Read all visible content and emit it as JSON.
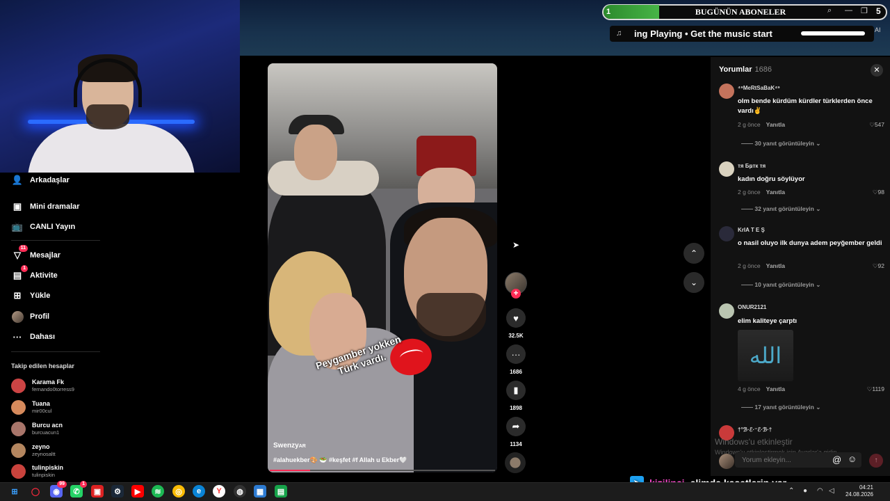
{
  "stream_overlay": {
    "subscriber_goal": {
      "count": "1",
      "title": "BUGÜNÜN ABONELER",
      "digit": "5"
    },
    "music_ticker": {
      "text": "ing Playing  •  Get the music start",
      "ai_label": "AI"
    },
    "chat_message": {
      "user": "kizilinci",
      "text": "elimde kasetlerin var"
    }
  },
  "sidebar": {
    "items": [
      {
        "label": "Arkadaşlar",
        "icon": "friends-icon"
      },
      {
        "label": "Mini dramalar",
        "icon": "mini-drama-icon"
      },
      {
        "label": "CANLI Yayın",
        "icon": "live-icon"
      },
      {
        "label": "Mesajlar",
        "icon": "messages-icon",
        "badge": "11"
      },
      {
        "label": "Aktivite",
        "icon": "activity-icon",
        "badge": "1"
      },
      {
        "label": "Yükle",
        "icon": "upload-icon"
      },
      {
        "label": "Profil",
        "icon": "profile-avatar"
      },
      {
        "label": "Dahası",
        "icon": "more-icon"
      }
    ],
    "following_title": "Takip edilen hesaplar",
    "following": [
      {
        "name": "Karama Fk",
        "handle": "fernando0torress9",
        "color": "#c44"
      },
      {
        "name": "Tuana",
        "handle": "mir00cul",
        "color": "#d68a5c"
      },
      {
        "name": "Burcu acn",
        "handle": "burcuacun1",
        "color": "#a8756a"
      },
      {
        "name": "zeyno",
        "handle": "zeynosaltt",
        "color": "#b4865f"
      },
      {
        "name": "tulinpiskin",
        "handle": "tulinpiskin",
        "color": "#c9433d"
      }
    ]
  },
  "video": {
    "caption_line1": "Peygamber yokken",
    "caption_line2": "Türk vardı.",
    "author": "Swenzy",
    "author_suffix": "AR",
    "tags": "#alahuekber🎨 🥗 #keşfet #f Allah u Ekber🤍",
    "progress": 0.18
  },
  "actions": {
    "likes": "32.5K",
    "comments": "1686",
    "saves": "1898",
    "shares": "1134"
  },
  "comments_panel": {
    "title": "Yorumlar",
    "count": "1686",
    "reply_label": "Yanıtla",
    "input_placeholder": "Yorum ekleyin...",
    "comments": [
      {
        "user": "⁴⁹MeRtSaBaK⁴⁹",
        "text": "olm bende kürdüm kürdler türklerden önce vardı✌",
        "time": "2 g önce",
        "likes": "547",
        "replies": "30 yanıt görüntüleyin",
        "color": "#c4735c"
      },
      {
        "user": "тя Бҏтк тя",
        "text": "kadın doğru söylüyor",
        "time": "2 g önce",
        "likes": "98",
        "replies": "32 yanıt görüntüleyin",
        "color": "#d9d2bf"
      },
      {
        "user": "KrIA T E Ş",
        "text": "o nasil oluyo ilk dunya adem peyğember geldi",
        "time": "2 g önce",
        "likes": "92",
        "replies": "10 yanıt görüntüleyin",
        "color": "#2a2a3a"
      },
      {
        "user": "ONUR2121",
        "text": "elim kaliteye çarptı",
        "time": "4 g önce",
        "likes": "1119",
        "replies": "17 yanıt görüntüleyin",
        "color": "#b9c4b0",
        "image_glyph": "الله"
      },
      {
        "user": "†°ℬ·ℰ·⁻ℰ·ℬ·†",
        "text": "",
        "color": "#c93a3a"
      }
    ],
    "watermark_line1": "Windows'u etkinleştir",
    "watermark_line2": "Windows'u etkinleştirmek için Ayarlar'a gidin."
  },
  "taskbar": {
    "time": "04:21",
    "date": "24.08.2026",
    "apps": [
      "windows-start-icon",
      "opera-gx-icon",
      "discord-icon",
      "whatsapp-icon",
      "app-red-icon",
      "steam-icon",
      "youtube-icon",
      "spotify-icon",
      "chrome-icon",
      "edge-icon",
      "yandex-icon",
      "obs-icon",
      "photos-icon",
      "notepad-icon"
    ],
    "discord_badge": "99",
    "whatsapp_badge": "1"
  },
  "colors": {
    "accent": "#fe2c55",
    "panel": "#121212",
    "sub_green": "#47b447"
  }
}
